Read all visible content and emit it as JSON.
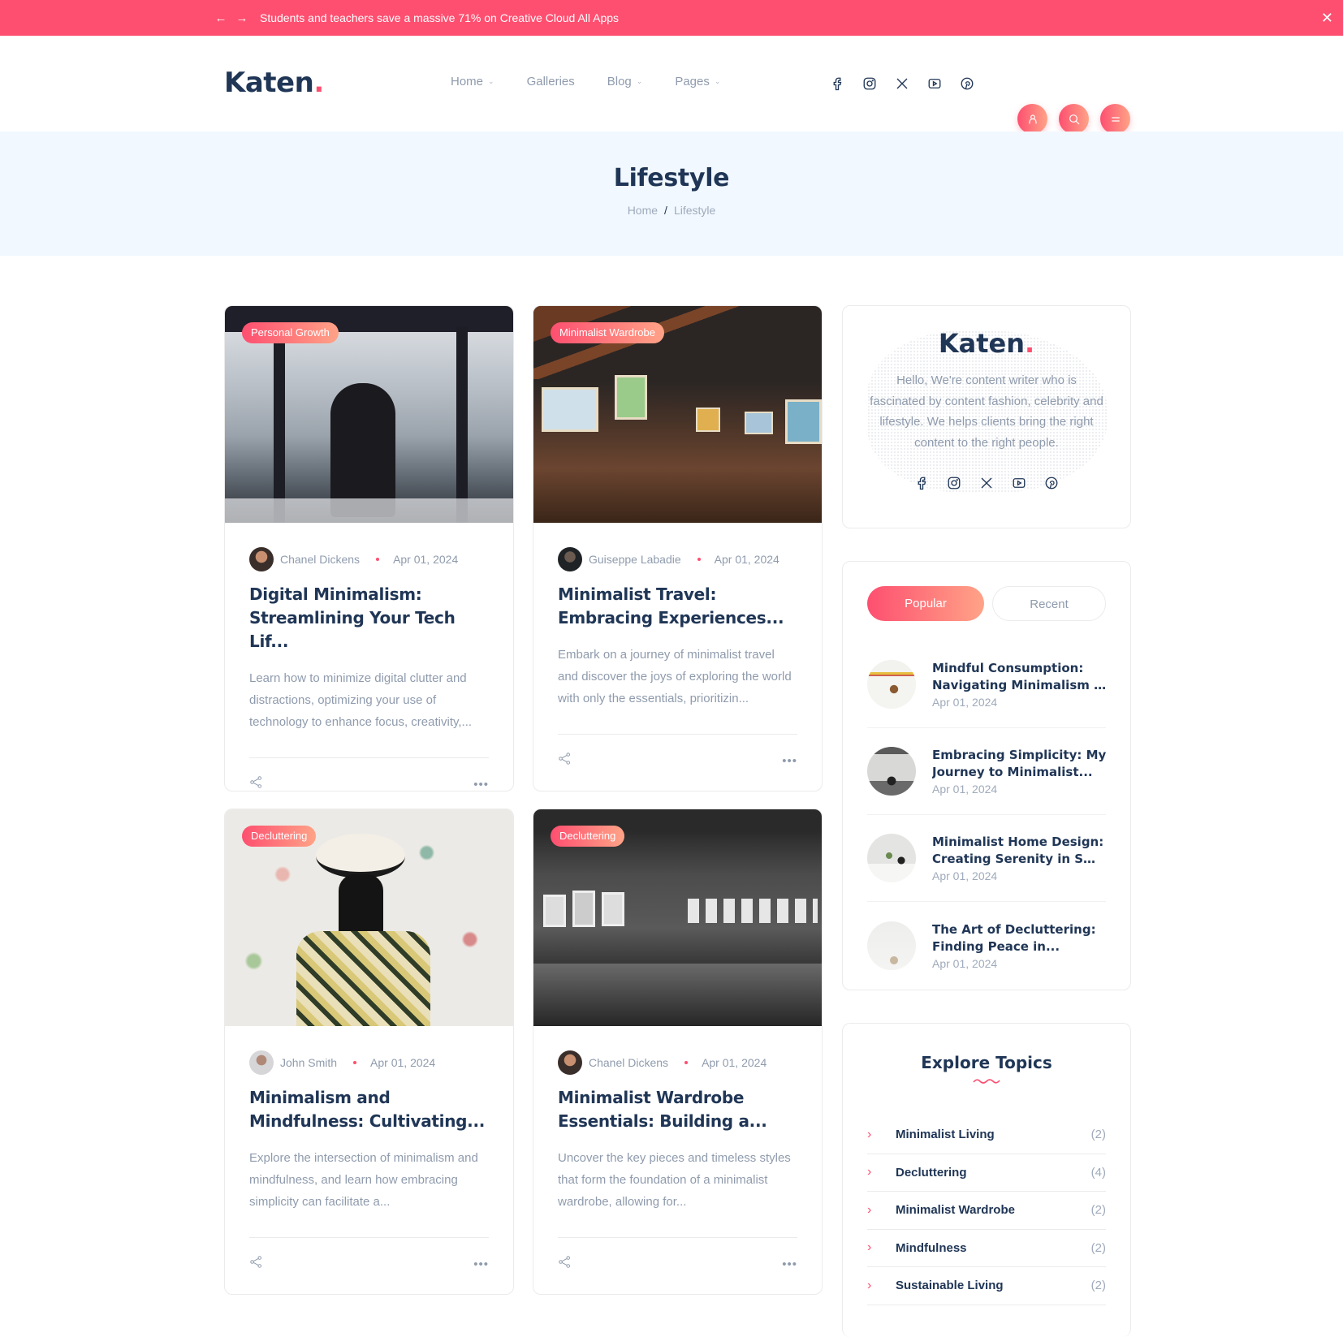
{
  "topbar": {
    "message": "Students and teachers save a massive 71% on Creative Cloud All Apps",
    "prev_icon": "arrow-left-icon",
    "next_icon": "arrow-right-icon",
    "close_icon": "close-icon",
    "background": "#fe4f70"
  },
  "header": {
    "logo": "Katen",
    "logo_dot": ".",
    "nav": [
      {
        "label": "Home",
        "dropdown": true
      },
      {
        "label": "Galleries",
        "dropdown": false
      },
      {
        "label": "Blog",
        "dropdown": true
      },
      {
        "label": "Pages",
        "dropdown": true
      }
    ],
    "socials": [
      "facebook-icon",
      "instagram-icon",
      "x-twitter-icon",
      "youtube-icon",
      "pinterest-icon"
    ],
    "buttons": [
      "user-icon",
      "search-icon",
      "menu-icon"
    ]
  },
  "hero": {
    "title": "Lifestyle",
    "breadcrumb": [
      "Home",
      "/",
      "Lifestyle"
    ]
  },
  "posts": [
    {
      "category": "Personal Growth",
      "author": "Chanel Dickens",
      "date": "Apr 01, 2024",
      "title": "Digital Minimalism: Streamlining Your Tech Lif...",
      "excerpt": "Learn how to minimize digital clutter and distractions, optimizing your use of technology to enhance focus, creativity,..."
    },
    {
      "category": "Minimalist Wardrobe",
      "author": "Guiseppe Labadie",
      "date": "Apr 01, 2024",
      "title": "Minimalist Travel: Embracing Experiences...",
      "excerpt": "Embark on a journey of minimalist travel and discover the joys of exploring the world with only the essentials, prioritizin..."
    },
    {
      "category": "Decluttering",
      "author": "John Smith",
      "date": "Apr 01, 2024",
      "title": "Minimalism and Mindfulness: Cultivating...",
      "excerpt": "Explore the intersection of minimalism and mindfulness, and learn how embracing simplicity can facilitate a..."
    },
    {
      "category": "Decluttering",
      "author": "Chanel Dickens",
      "date": "Apr 01, 2024",
      "title": "Minimalist Wardrobe Essentials: Building a...",
      "excerpt": "Uncover the key pieces and timeless styles that form the foundation of a minimalist wardrobe, allowing for..."
    }
  ],
  "more_label": "•••",
  "about": {
    "logo": "Katen",
    "logo_dot": ".",
    "text": "Hello, We're content writer who is fascinated by content fashion, celebrity and lifestyle. We helps clients bring the right content to the right people."
  },
  "popular": {
    "tabs": [
      {
        "label": "Popular",
        "active": true
      },
      {
        "label": "Recent",
        "active": false
      }
    ],
    "items": [
      {
        "title": "Mindful Consumption: Navigating Minimalism in ...",
        "line1": "Mindful Consumption:",
        "line2": "Navigating Minimalism in ...",
        "date": "Apr 01, 2024"
      },
      {
        "title": "Embracing Simplicity: My Journey to Minimalist...",
        "line1": "Embracing Simplicity: My",
        "line2": "Journey to Minimalist...",
        "date": "Apr 01, 2024"
      },
      {
        "title": "Minimalist Home Design: Creating Serenity in Small...",
        "line1": "Minimalist Home Design:",
        "line2": "Creating Serenity in Small...",
        "date": "Apr 01, 2024"
      },
      {
        "title": "The Art of Decluttering: Finding Peace in...",
        "line1": "The Art of Decluttering:",
        "line2": "Finding Peace in...",
        "date": "Apr 01, 2024"
      }
    ]
  },
  "topics": {
    "title": "Explore Topics",
    "items": [
      {
        "name": "Minimalist Living",
        "count": "(2)"
      },
      {
        "name": "Decluttering",
        "count": "(4)"
      },
      {
        "name": "Minimalist Wardrobe",
        "count": "(2)"
      },
      {
        "name": "Mindfulness",
        "count": "(2)"
      },
      {
        "name": "Sustainable Living",
        "count": "(2)"
      }
    ]
  },
  "colors": {
    "accent": "#fe4f70",
    "accent_gradient_end": "#ffa387",
    "heading": "#203656",
    "muted": "#8f9bad",
    "hero_bg": "#f1f8ff"
  }
}
